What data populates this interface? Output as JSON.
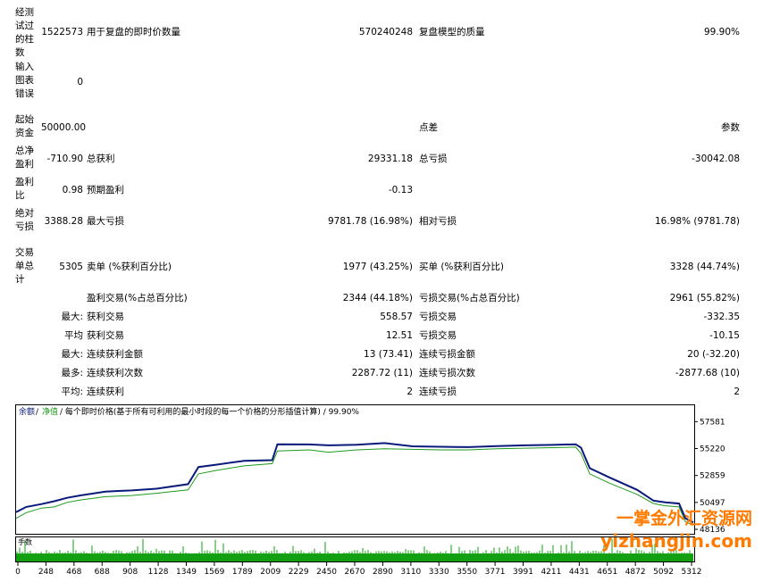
{
  "report": {
    "bars_tested": {
      "label": "经测\n试过\n的柱\n数",
      "value": "1522573"
    },
    "ticks_modelled": {
      "label": "用于复盘的即时价数量",
      "value": "570240248"
    },
    "modelling_quality": {
      "label": "复盘模型的质量",
      "value": "99.90%"
    },
    "mismatched_errors": {
      "label": "输入\n图表\n错误",
      "value": "0"
    },
    "initial_deposit": {
      "label": "起始\n资金",
      "value": "50000.00"
    },
    "spread": {
      "label": "点差",
      "value": "参数"
    },
    "total_net_profit": {
      "label": "总净\n盈利",
      "value": "-710.90"
    },
    "gross_profit": {
      "label": "总获利",
      "value": "29331.18"
    },
    "gross_loss": {
      "label": "总亏损",
      "value": "-30042.08"
    },
    "profit_factor": {
      "label": "盈利\n比",
      "value": "0.98"
    },
    "expected_payoff": {
      "label": "预期盈利",
      "value": "-0.13"
    },
    "absolute_drawdown": {
      "label": "绝对\n亏损",
      "value": "3388.28"
    },
    "maximal_drawdown": {
      "label": "最大亏损",
      "value": "9781.78 (16.98%)"
    },
    "relative_drawdown": {
      "label": "相对亏损",
      "value": "16.98% (9781.78)"
    },
    "total_trades": {
      "label": "交易\n单总\n计",
      "value": "5305"
    },
    "short_positions": {
      "label": "卖单 (%获利百分比)",
      "value": "1977 (43.25%)"
    },
    "long_positions": {
      "label": "买单 (%获利百分比)",
      "value": "3328 (44.74%)"
    },
    "profit_trades": {
      "label": "盈利交易(%占总百分比)",
      "value": "2344 (44.18%)"
    },
    "loss_trades": {
      "label": "亏损交易(%占总百分比)",
      "value": "2961 (55.82%)"
    },
    "largest": {
      "prefix": "最大:",
      "profit_label": "获利交易",
      "profit_value": "558.57",
      "loss_label": "亏损交易",
      "loss_value": "-332.35"
    },
    "average": {
      "prefix": "平均",
      "profit_label": "获利交易",
      "profit_value": "12.51",
      "loss_label": "亏损交易",
      "loss_value": "-10.15"
    },
    "max_consecutive": {
      "prefix": "最大:",
      "wins_label": "连续获利金额",
      "wins_value": "13 (73.41)",
      "losses_label": "连续亏损金额",
      "losses_value": "20 (-32.20)"
    },
    "max_consecutive_amount": {
      "prefix": "最多:",
      "wins_label": "连续获利次数",
      "wins_value": "2287.72 (11)",
      "losses_label": "连续亏损次数",
      "losses_value": "-2877.68 (10)"
    },
    "average_consecutive": {
      "prefix": "平均:",
      "wins_label": "连续获利",
      "wins_value": "2",
      "losses_label": "连续亏损",
      "losses_value": "2"
    }
  },
  "chart_header": {
    "balance": "余额",
    "separator": "/",
    "equity": "净值",
    "note": "/ 每个即时价格(基于所有可利用的最小时段的每一个价格的分形插值计算) / 99.90%"
  },
  "volume_label": "手数",
  "watermark": {
    "line1": "一掌金外汇资源网",
    "line2": "yizhangjin.com"
  },
  "colors": {
    "balance": "#0a1a7a",
    "equity": "#1e9a1e",
    "volume": "#12a012",
    "watermark": "#ff7a00"
  },
  "chart_data": {
    "type": "line",
    "x_ticks": [
      "0",
      "248",
      "468",
      "688",
      "908",
      "1128",
      "1349",
      "1569",
      "1789",
      "2009",
      "2229",
      "2450",
      "2670",
      "2890",
      "3110",
      "3330",
      "3550",
      "3771",
      "3991",
      "4211",
      "4431",
      "4651",
      "4872",
      "5092",
      "5312"
    ],
    "y_ticks": [
      "57581",
      "55220",
      "52859",
      "50497",
      "48136"
    ],
    "ylim": [
      48136,
      58000
    ],
    "xlim": [
      0,
      5312
    ],
    "series": [
      {
        "name": "余额",
        "points": [
          [
            0,
            49650
          ],
          [
            80,
            50100
          ],
          [
            200,
            50350
          ],
          [
            300,
            50600
          ],
          [
            400,
            50900
          ],
          [
            500,
            51100
          ],
          [
            700,
            51450
          ],
          [
            908,
            51550
          ],
          [
            1100,
            51700
          ],
          [
            1349,
            52100
          ],
          [
            1430,
            53600
          ],
          [
            1569,
            53800
          ],
          [
            1789,
            54150
          ],
          [
            2009,
            54200
          ],
          [
            2050,
            55600
          ],
          [
            2300,
            55580
          ],
          [
            2450,
            55500
          ],
          [
            2670,
            55550
          ],
          [
            2890,
            55700
          ],
          [
            3110,
            55420
          ],
          [
            3330,
            55380
          ],
          [
            3550,
            55350
          ],
          [
            3771,
            55430
          ],
          [
            3991,
            55500
          ],
          [
            4211,
            55540
          ],
          [
            4390,
            55600
          ],
          [
            4431,
            55300
          ],
          [
            4500,
            53500
          ],
          [
            4651,
            52700
          ],
          [
            4872,
            51600
          ],
          [
            5000,
            50650
          ],
          [
            5092,
            50500
          ],
          [
            5200,
            50400
          ],
          [
            5250,
            49100
          ],
          [
            5312,
            48750
          ]
        ]
      },
      {
        "name": "净值",
        "points": [
          [
            0,
            49100
          ],
          [
            80,
            49600
          ],
          [
            200,
            50000
          ],
          [
            300,
            50100
          ],
          [
            400,
            50500
          ],
          [
            500,
            50700
          ],
          [
            700,
            51000
          ],
          [
            908,
            51100
          ],
          [
            1100,
            51300
          ],
          [
            1349,
            51600
          ],
          [
            1430,
            53000
          ],
          [
            1569,
            53300
          ],
          [
            1789,
            53700
          ],
          [
            2009,
            53900
          ],
          [
            2050,
            55000
          ],
          [
            2300,
            55100
          ],
          [
            2450,
            54900
          ],
          [
            2670,
            55100
          ],
          [
            2890,
            55200
          ],
          [
            3110,
            55150
          ],
          [
            3330,
            55100
          ],
          [
            3550,
            55100
          ],
          [
            3771,
            55200
          ],
          [
            3991,
            55250
          ],
          [
            4211,
            55300
          ],
          [
            4390,
            55350
          ],
          [
            4431,
            54800
          ],
          [
            4500,
            53000
          ],
          [
            4651,
            52200
          ],
          [
            4872,
            51200
          ],
          [
            5000,
            50400
          ],
          [
            5092,
            50200
          ],
          [
            5200,
            50100
          ],
          [
            5250,
            48800
          ],
          [
            5312,
            48500
          ]
        ]
      }
    ],
    "volume_level": 0.33
  }
}
